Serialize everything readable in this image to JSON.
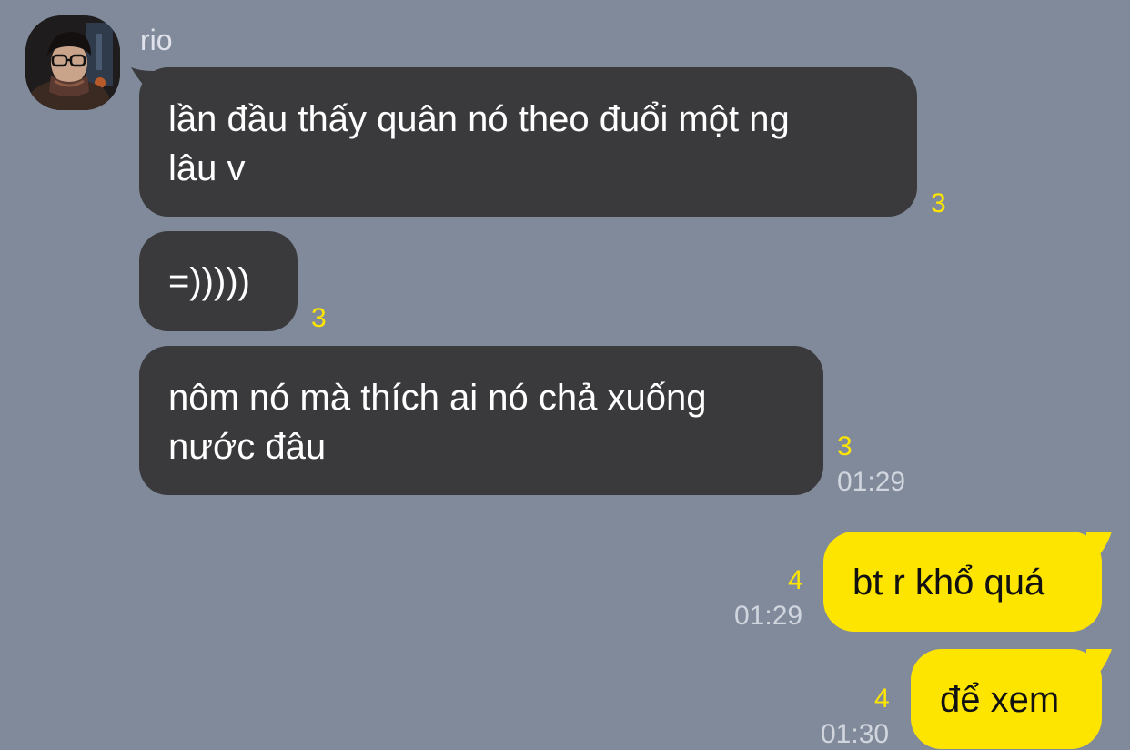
{
  "chat": {
    "sender_name": "rio",
    "incoming": [
      {
        "text_lines": [
          "lần đầu thấy quân nó theo đuổi một ng",
          "lâu v"
        ],
        "unread": "3"
      },
      {
        "text_lines": [
          "=)))))"
        ],
        "unread": "3"
      },
      {
        "text_lines": [
          "nôm nó mà thích ai nó chả xuống",
          "nước đâu"
        ],
        "unread": "3",
        "time": "01:29"
      }
    ],
    "outgoing": [
      {
        "text": "bt r khổ quá",
        "unread": "4",
        "time": "01:29"
      },
      {
        "text": "để xem",
        "unread": "4",
        "time": "01:30"
      }
    ]
  },
  "colors": {
    "background": "#818a9b",
    "incoming_bubble": "#3a3a3c",
    "outgoing_bubble": "#fee500",
    "unread_count": "#fee500"
  },
  "icons": {
    "avatar": "profile-photo"
  }
}
